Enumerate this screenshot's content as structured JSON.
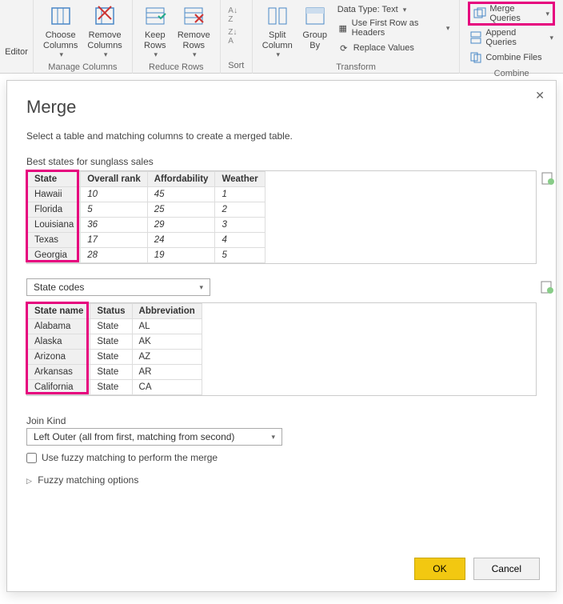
{
  "ribbon": {
    "editor_label": "Editor",
    "manage_columns": {
      "choose_label": "Choose\nColumns",
      "remove_label": "Remove\nColumns",
      "group_label": "Manage Columns"
    },
    "reduce_rows": {
      "keep_label": "Keep\nRows",
      "remove_label": "Remove\nRows",
      "group_label": "Reduce Rows"
    },
    "sort": {
      "group_label": "Sort"
    },
    "transform": {
      "split_label": "Split\nColumn",
      "group_label_btn": "Group\nBy",
      "datatype_label": "Data Type: Text",
      "first_row_label": "Use First Row as Headers",
      "replace_label": "Replace Values",
      "group_label": "Transform"
    },
    "combine": {
      "merge_label": "Merge Queries",
      "append_label": "Append Queries",
      "combine_files_label": "Combine Files",
      "group_label": "Combine"
    }
  },
  "dialog": {
    "title": "Merge",
    "desc": "Select a table and matching columns to create a merged table.",
    "table1_label": "Best states for sunglass sales",
    "table1": {
      "headers": [
        "State",
        "Overall rank",
        "Affordability",
        "Weather"
      ],
      "rows": [
        [
          "Hawaii",
          "10",
          "45",
          "1"
        ],
        [
          "Florida",
          "5",
          "25",
          "2"
        ],
        [
          "Louisiana",
          "36",
          "29",
          "3"
        ],
        [
          "Texas",
          "17",
          "24",
          "4"
        ],
        [
          "Georgia",
          "28",
          "19",
          "5"
        ]
      ]
    },
    "table2_dd": "State codes",
    "table2": {
      "headers": [
        "State name",
        "Status",
        "Abbreviation"
      ],
      "rows": [
        [
          "Alabama",
          "State",
          "AL"
        ],
        [
          "Alaska",
          "State",
          "AK"
        ],
        [
          "Arizona",
          "State",
          "AZ"
        ],
        [
          "Arkansas",
          "State",
          "AR"
        ],
        [
          "California",
          "State",
          "CA"
        ]
      ]
    },
    "join_label": "Join Kind",
    "join_value": "Left Outer (all from first, matching from second)",
    "fuzzy_label": "Use fuzzy matching to perform the merge",
    "fuzzy_options": "Fuzzy matching options",
    "ok": "OK",
    "cancel": "Cancel"
  }
}
